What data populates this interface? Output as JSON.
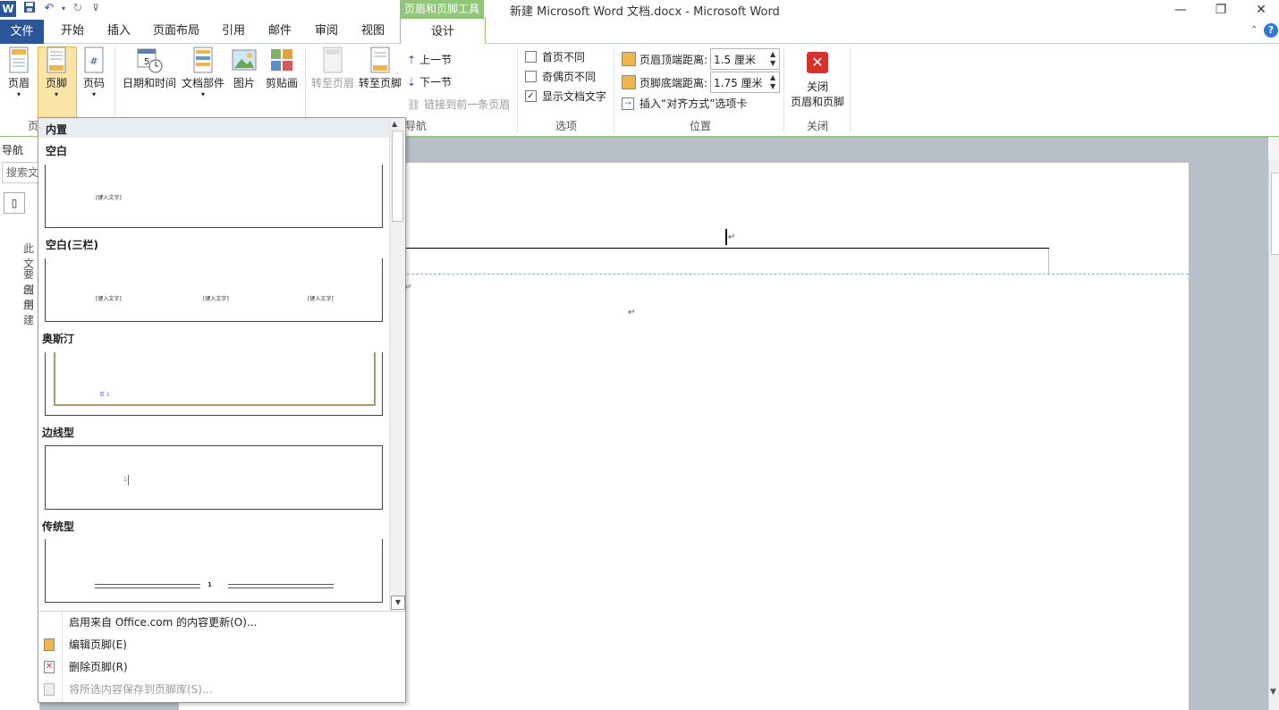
{
  "window": {
    "title": "新建 Microsoft Word 文档.docx  -  Microsoft Word",
    "context_tab_group": "页眉和页脚工具",
    "app_icon": "W"
  },
  "tabs": {
    "file": "文件",
    "home": "开始",
    "insert": "插入",
    "layout": "页面布局",
    "references": "引用",
    "mailings": "邮件",
    "review": "审阅",
    "view": "视图",
    "design": "设计"
  },
  "ribbon": {
    "header_btn": "页眉",
    "footer_btn": "页脚",
    "pagenum_btn": "页码",
    "datetime_btn": "日期和时间",
    "docparts_btn": "文档部件",
    "picture_btn": "图片",
    "clipart_btn": "剪贴画",
    "goto_header": "转至页眉",
    "goto_footer": "转至页脚",
    "prev_section": "上一节",
    "next_section": "下一节",
    "link_prev": "链接到前一条页眉",
    "nav_group": "导航",
    "diff_first": "首页不同",
    "diff_oddeven": "奇偶页不同",
    "show_doc_text": "显示文档文字",
    "options_group": "选项",
    "header_top_label": "页眉顶端距离:",
    "header_top_value": "1.5 厘米",
    "footer_bottom_label": "页脚底端距离:",
    "footer_bottom_value": "1.75 厘米",
    "insert_align_tab": "插入“对齐方式”选项卡",
    "position_group": "位置",
    "close_btn_line1": "关闭",
    "close_btn_line2": "页眉和页脚",
    "close_group": "关闭",
    "hf_group_partial": "页"
  },
  "navpane": {
    "title": "导航",
    "search_partial": "搜索文",
    "text_1": "此文",
    "text_2": "要创",
    "text_3": "应用",
    "text_4": "创建"
  },
  "dropdown": {
    "section_header": "内置",
    "gallery": [
      {
        "name": "空白",
        "placeholders": [
          "[键入文字]"
        ]
      },
      {
        "name": "空白(三栏)",
        "placeholders": [
          "[键入文字]",
          "[键入文字]",
          "[键入文字]"
        ]
      },
      {
        "name": "奥斯汀",
        "placeholders": [
          "页 1"
        ]
      },
      {
        "name": "边线型",
        "placeholders": [
          "1"
        ]
      },
      {
        "name": "传统型",
        "placeholders": [
          "1"
        ]
      }
    ],
    "menu": [
      {
        "label": "启用来自 Office.com 的内容更新(O)...",
        "enabled": true
      },
      {
        "label": "编辑页脚(E)",
        "enabled": true
      },
      {
        "label": "删除页脚(R)",
        "enabled": true
      },
      {
        "label": "将所选内容保存到页脚库(S)...",
        "enabled": false
      }
    ]
  },
  "document": {
    "para_mark": "↵"
  },
  "colors": {
    "file_tab": "#2b579a",
    "context_green": "#8fc776",
    "close_red": "#d9302c"
  }
}
